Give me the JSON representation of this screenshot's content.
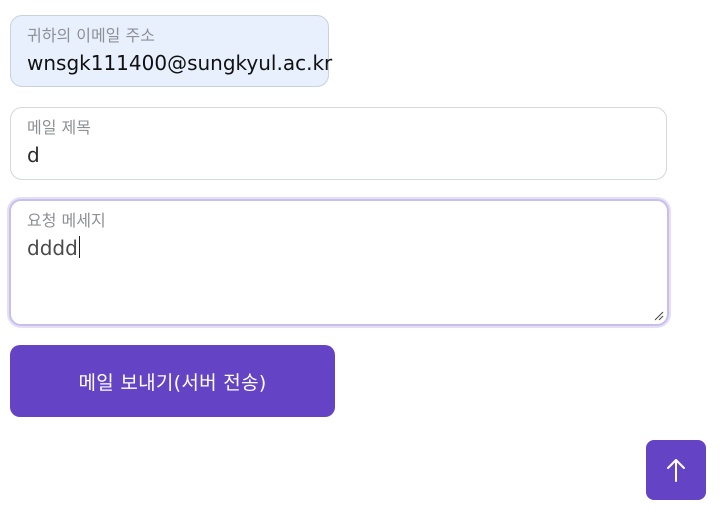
{
  "form": {
    "email": {
      "label": "귀하의 이메일 주소",
      "value": "wnsgk111400@sungkyul.ac.kr"
    },
    "subject": {
      "label": "메일 제목",
      "value": "d"
    },
    "message": {
      "label": "요청 메세지",
      "value": "dddd"
    },
    "submit_label": "메일 보내기(서버 전송)"
  },
  "scroll_top": {
    "icon": "arrow-up-icon"
  },
  "colors": {
    "accent": "#6444c4",
    "autofill_bg": "#e8f0fe",
    "focus_ring": "#c8c0ea"
  }
}
